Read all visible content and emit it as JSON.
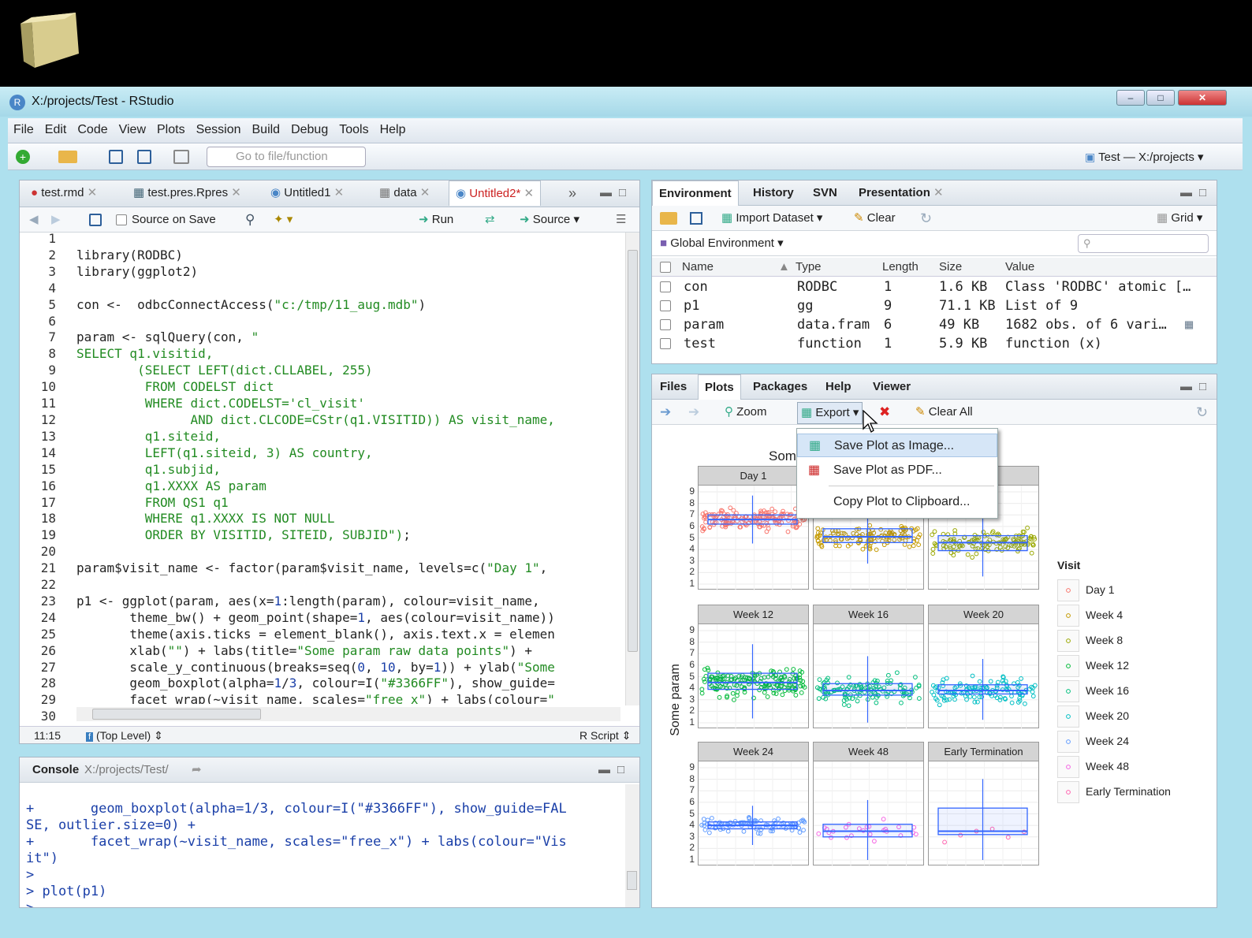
{
  "window": {
    "title": "X:/projects/Test - RStudio",
    "min": "–",
    "max": "□",
    "close": "✕"
  },
  "menu": [
    "File",
    "Edit",
    "Code",
    "View",
    "Plots",
    "Session",
    "Build",
    "Debug",
    "Tools",
    "Help"
  ],
  "toolbar": {
    "goto_placeholder": "Go to file/function",
    "project": "Test — X:/projects"
  },
  "editor": {
    "tabs": [
      "test.rmd",
      "test.pres.Rpres",
      "Untitled1",
      "data",
      "Untitled2*"
    ],
    "source_on_save": "Source on Save",
    "run": "Run",
    "source": "Source",
    "line_numbers": [
      "1",
      "2",
      "3",
      "4",
      "5",
      "6",
      "7",
      "8",
      "9",
      "10",
      "11",
      "12",
      "13",
      "14",
      "15",
      "16",
      "17",
      "18",
      "19",
      "20",
      "21",
      "22",
      "23",
      "24",
      "25",
      "26",
      "27",
      "28",
      "29",
      "30"
    ],
    "status": {
      "pos": "11:15",
      "scope": "(Top Level)",
      "type": "R Script"
    }
  },
  "console": {
    "title": "Console",
    "path": "X:/projects/Test/",
    "lines": [
      "+       geom_boxplot(alpha=1/3, colour=I(\"#3366FF\"), show_guide=FAL",
      "SE, outlier.size=0) +",
      "+       facet_wrap(~visit_name, scales=\"free_x\") + labs(colour=\"Vis",
      "it\")",
      ">",
      "> plot(p1)",
      "> "
    ]
  },
  "environment": {
    "tabs": [
      "Environment",
      "History",
      "SVN",
      "Presentation"
    ],
    "import": "Import Dataset",
    "clear": "Clear",
    "grid": "Grid",
    "scope": "Global Environment",
    "columns": [
      "Name",
      "Type",
      "Length",
      "Size",
      "Value"
    ],
    "rows": [
      {
        "name": "con",
        "type": "RODBC",
        "length": "1",
        "size": "1.6 KB",
        "value": "Class 'RODBC' atomic […"
      },
      {
        "name": "p1",
        "type": "gg",
        "length": "9",
        "size": "71.1 KB",
        "value": "List of 9"
      },
      {
        "name": "param",
        "type": "data.fram",
        "length": "6",
        "size": "49 KB",
        "value": "1682 obs. of 6 vari…"
      },
      {
        "name": "test",
        "type": "function",
        "length": "1",
        "size": "5.9 KB",
        "value": "function (x)"
      }
    ]
  },
  "files": {
    "tabs": [
      "Files",
      "Plots",
      "Packages",
      "Help",
      "Viewer"
    ],
    "zoom": "Zoom",
    "export": "Export",
    "clear_all": "Clear All"
  },
  "export_menu": [
    "Save Plot as Image...",
    "Save Plot as PDF...",
    "Copy Plot to Clipboard..."
  ],
  "chart_data": {
    "type": "scatter",
    "title": "Som",
    "ylabel": "Some param",
    "legend_title": "Visit",
    "legend_position": "right",
    "y_ticks": [
      "1",
      "2",
      "3",
      "4",
      "5",
      "6",
      "7",
      "8",
      "9"
    ],
    "ylim": [
      1,
      9
    ],
    "facets": [
      {
        "name": "Day 1",
        "color": "#F8766D",
        "center": 6.6,
        "q1": 6.2,
        "q3": 7.0,
        "spread": 1.2,
        "n": 160
      },
      {
        "name": "",
        "color": "#C49A00",
        "center": 5.1,
        "q1": 4.6,
        "q3": 5.8,
        "spread": 1.3,
        "n": 130
      },
      {
        "name": "",
        "color": "#99A800",
        "center": 4.6,
        "q1": 3.9,
        "q3": 5.2,
        "spread": 1.6,
        "n": 130
      },
      {
        "name": "Week 12",
        "color": "#00BA38",
        "center": 4.5,
        "q1": 3.9,
        "q3": 5.3,
        "spread": 1.8,
        "n": 170
      },
      {
        "name": "Week 16",
        "color": "#00BF7D",
        "center": 3.8,
        "q1": 3.4,
        "q3": 4.4,
        "spread": 1.7,
        "n": 120
      },
      {
        "name": "Week 20",
        "color": "#00BFC4",
        "center": 3.8,
        "q1": 3.5,
        "q3": 4.3,
        "spread": 1.6,
        "n": 120
      },
      {
        "name": "Week 24",
        "color": "#619CFF",
        "center": 4.0,
        "q1": 3.7,
        "q3": 4.3,
        "spread": 1.0,
        "n": 90
      },
      {
        "name": "Week 48",
        "color": "#F564E3",
        "center": 3.5,
        "q1": 3.0,
        "q3": 4.1,
        "spread": 1.5,
        "n": 25
      },
      {
        "name": "Early Termination",
        "color": "#FF64B0",
        "center": 3.5,
        "q1": 3.2,
        "q3": 5.5,
        "spread": 1.8,
        "n": 6
      }
    ],
    "legend": [
      "Day 1",
      "Week 4",
      "Week 8",
      "Week 12",
      "Week 16",
      "Week 20",
      "Week 24",
      "Week 48",
      "Early Termination"
    ],
    "legend_colors": [
      "#F8766D",
      "#C49A00",
      "#99A800",
      "#00BA38",
      "#00BF7D",
      "#00BFC4",
      "#619CFF",
      "#F564E3",
      "#FF64B0"
    ]
  }
}
